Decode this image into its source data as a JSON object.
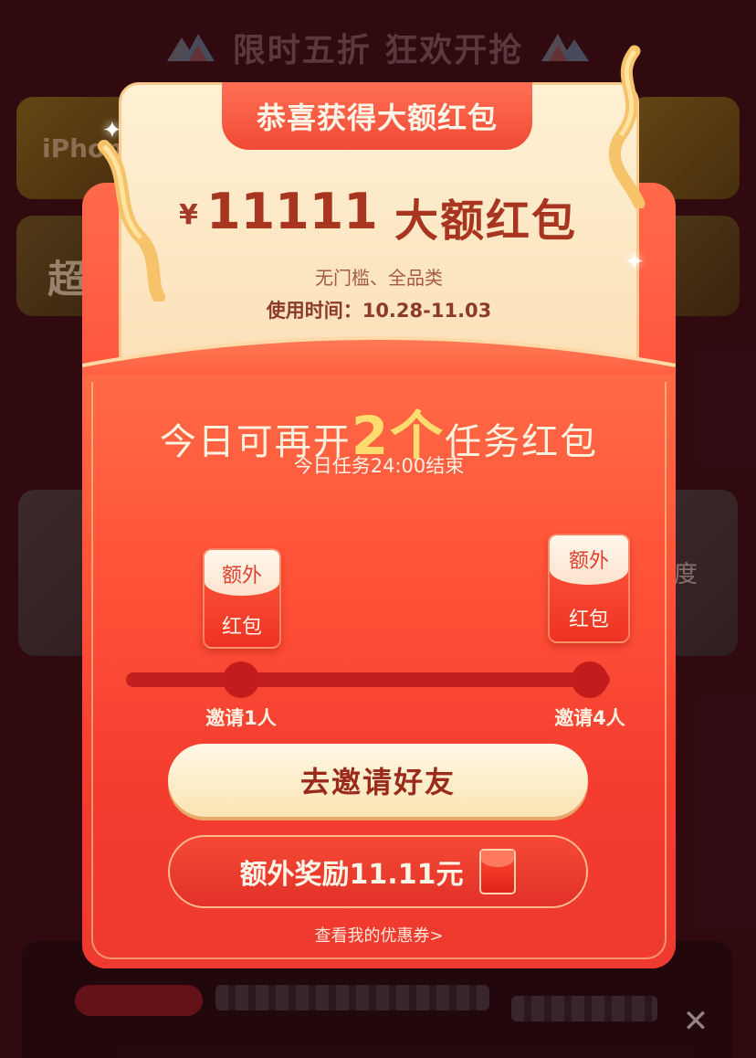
{
  "background": {
    "banner_text": "限时五折 狂欢开抢",
    "card1_text": "iPhone",
    "card2_text": "超",
    "card3_text": "度",
    "close_symbol": "✕"
  },
  "popup": {
    "title": "恭喜获得大额红包",
    "currency": "¥",
    "amount": "11111",
    "amount_label": "大额红包",
    "condition": "无门槛、全品类",
    "time_label": "使用时间：10.28-11.03",
    "task_title_prefix": "今日可再开",
    "task_count": "2个",
    "task_title_suffix": "任务红包",
    "task_sub": "今日任务24:00结束",
    "packets": [
      {
        "line1": "额外",
        "line2": "红包"
      },
      {
        "line1": "额外",
        "line2": "红包"
      }
    ],
    "milestones": [
      {
        "label": "邀请1人"
      },
      {
        "label": "邀请4人"
      }
    ],
    "progress": 0,
    "invite_button": "去邀请好友",
    "bonus_button": "额外奖励11.11元",
    "coupon_link": "查看我的优惠券>"
  },
  "colors": {
    "accent_red": "#f23a2e",
    "gold": "#ffdc6e",
    "cream": "#fbe4b4"
  },
  "icons": [
    "mountain-logo-icon",
    "sparkle-icon",
    "ribbon-icon",
    "red-packet-icon",
    "close-icon"
  ]
}
